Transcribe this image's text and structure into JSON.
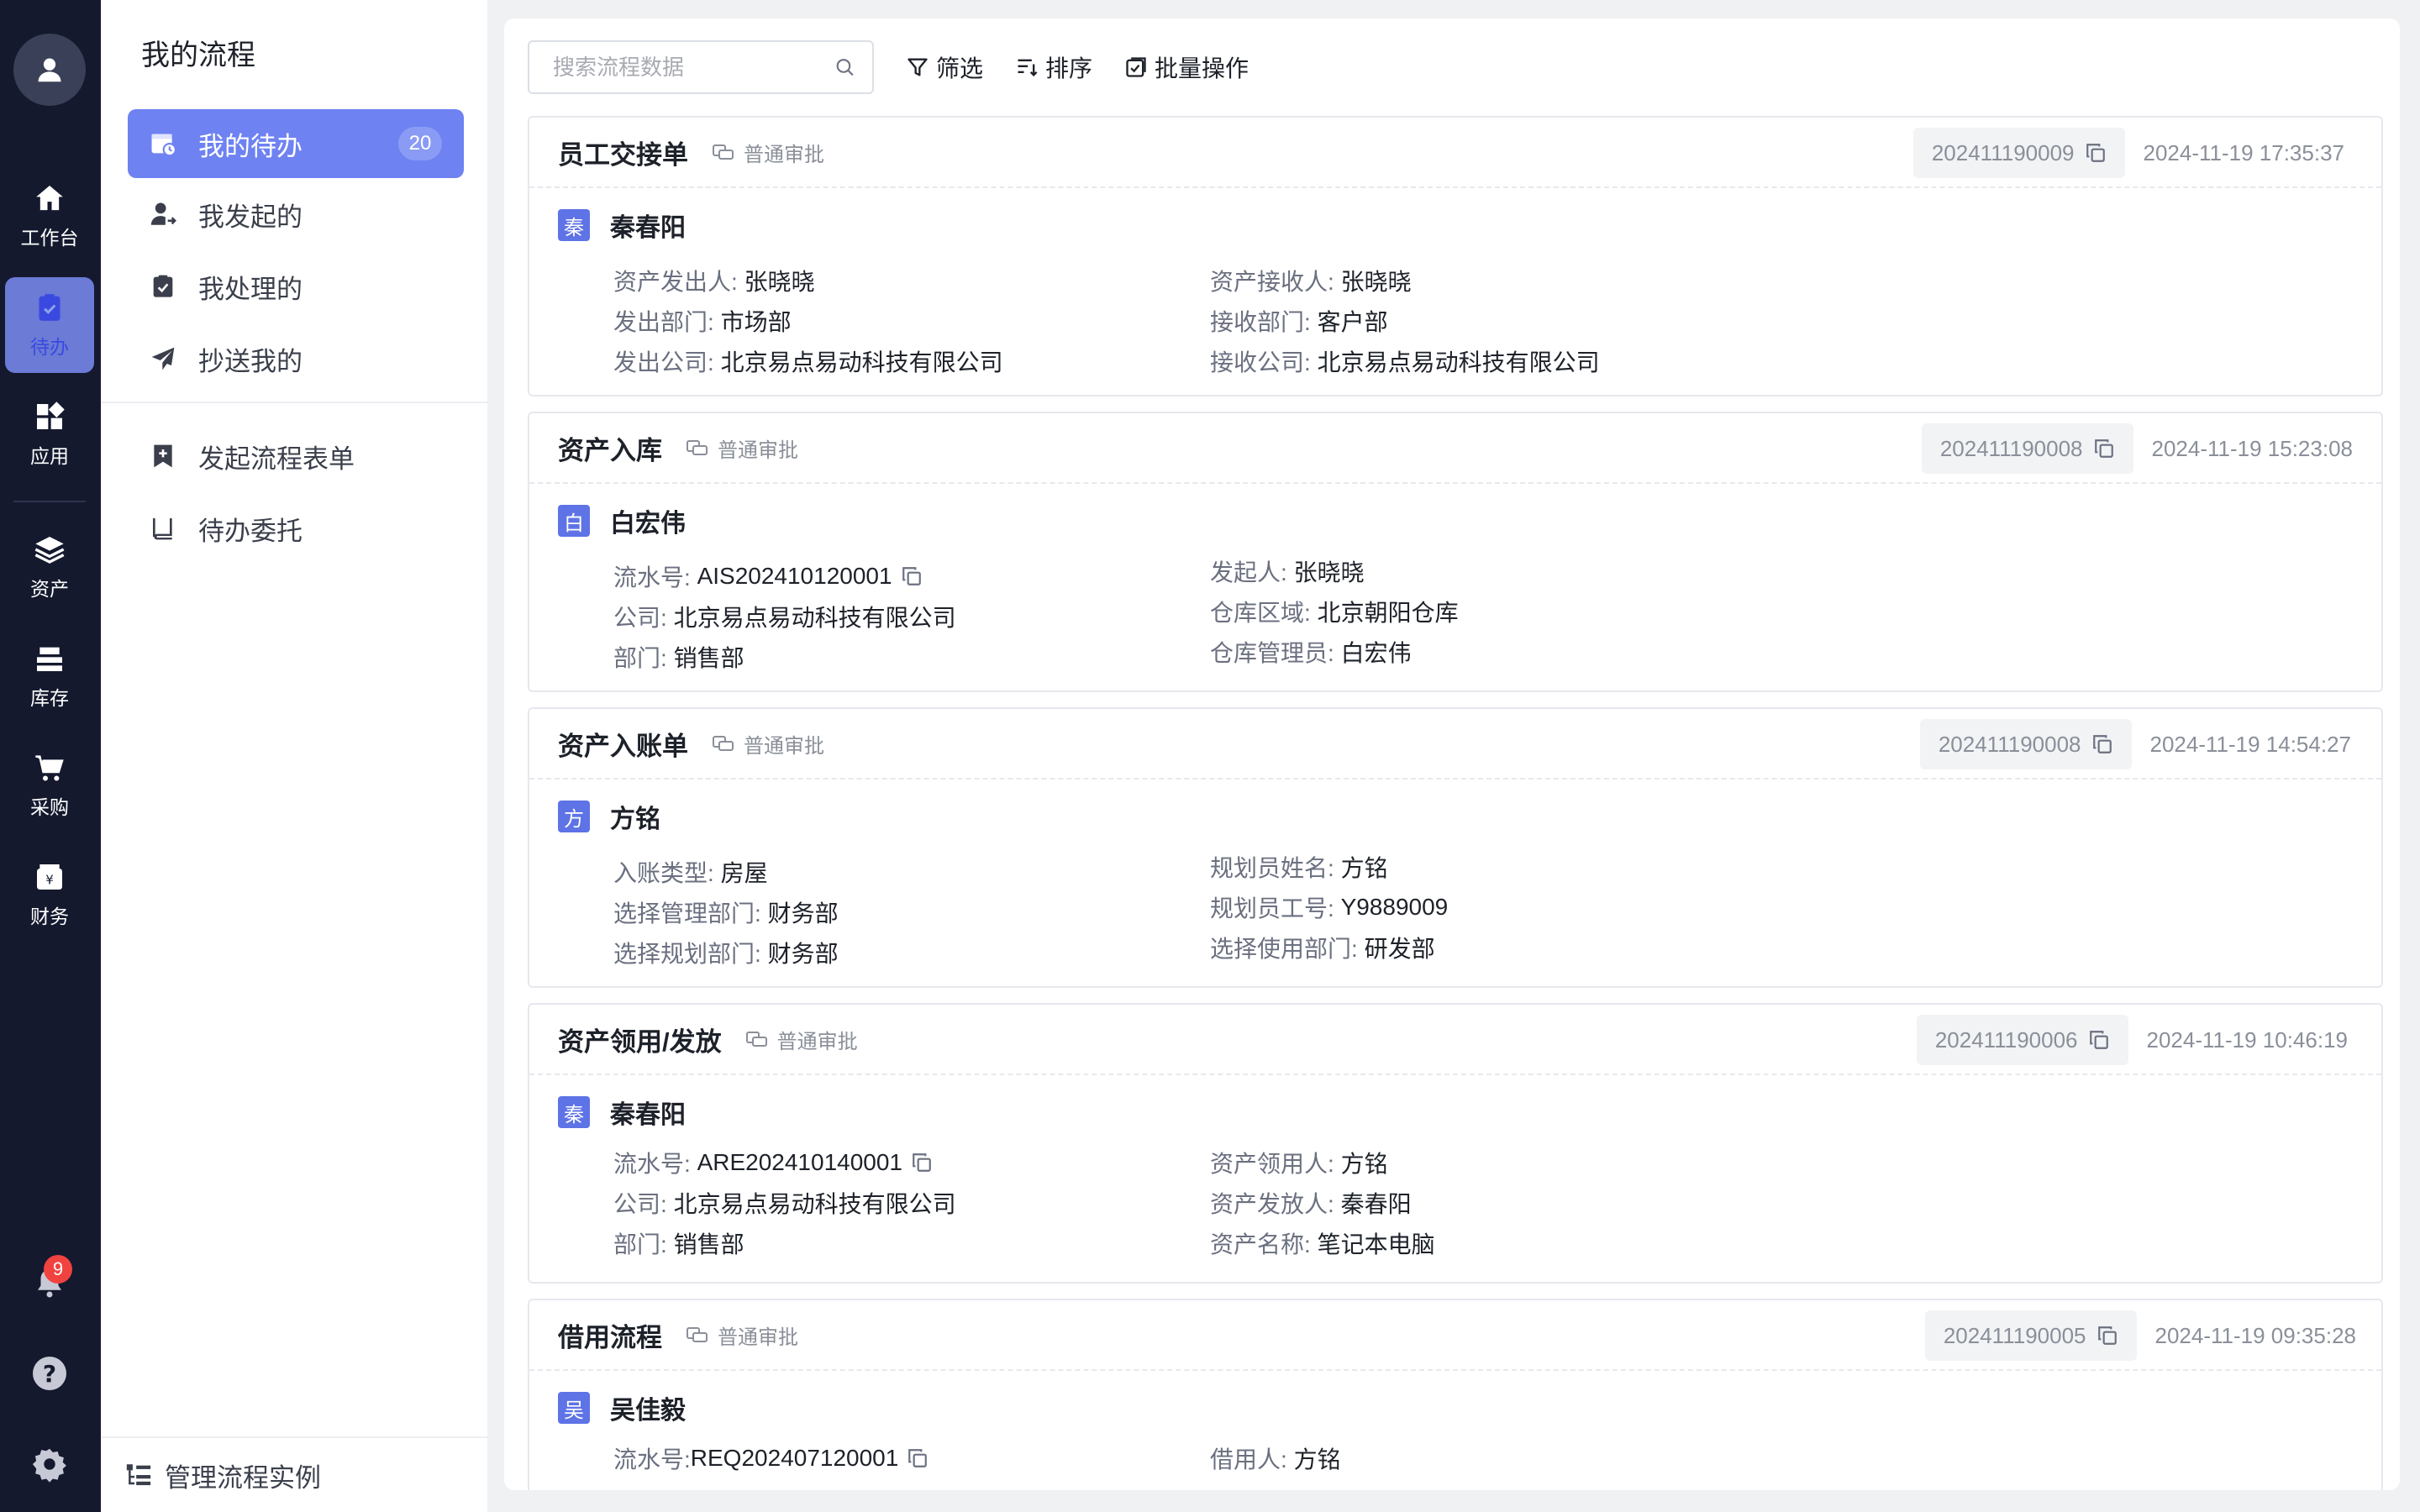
{
  "rail": {
    "items": [
      {
        "label": "工作台"
      },
      {
        "label": "待办"
      },
      {
        "label": "应用"
      },
      {
        "label": "资产"
      },
      {
        "label": "库存"
      },
      {
        "label": "采购"
      },
      {
        "label": "财务"
      }
    ],
    "notification_count": "9"
  },
  "sidebar": {
    "title": "我的流程",
    "items": [
      {
        "label": "我的待办",
        "count": "20"
      },
      {
        "label": "我发起的"
      },
      {
        "label": "我处理的"
      },
      {
        "label": "抄送我的"
      },
      {
        "label": "发起流程表单"
      },
      {
        "label": "待办委托"
      }
    ],
    "footer": "管理流程实例"
  },
  "toolbar": {
    "search_placeholder": "搜索流程数据",
    "filter": "筛选",
    "sort": "排序",
    "batch": "批量操作"
  },
  "cards": [
    {
      "title": "员工交接单",
      "tag": "普通审批",
      "flow_no": "202411190009",
      "time": "2024-11-19 17:35:37",
      "badge": "秦",
      "name": "秦春阳",
      "left": [
        {
          "k": "资产发出人:",
          "v": "张晓晓"
        },
        {
          "k": "发出部门:",
          "v": "市场部"
        },
        {
          "k": "发出公司:",
          "v": "北京易点易动科技有限公司"
        }
      ],
      "right": [
        {
          "k": "资产接收人:",
          "v": "张晓晓"
        },
        {
          "k": "接收部门:",
          "v": "客户部"
        },
        {
          "k": "接收公司:",
          "v": "北京易点易动科技有限公司"
        }
      ]
    },
    {
      "title": "资产入库",
      "tag": "普通审批",
      "flow_no": "202411190008",
      "time": "2024-11-19 15:23:08",
      "badge": "白",
      "name": "白宏伟",
      "left": [
        {
          "k": "流水号:",
          "v": "AIS202410120001"
        },
        {
          "k": "公司:",
          "v": "北京易点易动科技有限公司"
        },
        {
          "k": "部门:",
          "v": "销售部"
        }
      ],
      "right": [
        {
          "k": "发起人:",
          "v": "张晓晓"
        },
        {
          "k": "仓库区域:",
          "v": "北京朝阳仓库"
        },
        {
          "k": "仓库管理员:",
          "v": "白宏伟"
        }
      ]
    },
    {
      "title": "资产入账单",
      "tag": "普通审批",
      "flow_no": "202411190008",
      "time": "2024-11-19 14:54:27",
      "badge": "方",
      "name": "方铭",
      "left": [
        {
          "k": "入账类型:",
          "v": "房屋"
        },
        {
          "k": "选择管理部门:",
          "v": "财务部"
        },
        {
          "k": "选择规划部门:",
          "v": "财务部"
        }
      ],
      "right": [
        {
          "k": "规划员姓名:",
          "v": "方铭"
        },
        {
          "k": "规划员工号:",
          "v": "Y9889009"
        },
        {
          "k": "选择使用部门:",
          "v": "研发部"
        }
      ]
    },
    {
      "title": "资产领用/发放",
      "tag": "普通审批",
      "flow_no": "202411190006",
      "time": "2024-11-19 10:46:19",
      "badge": "秦",
      "name": "秦春阳",
      "left": [
        {
          "k": "流水号:",
          "v": "ARE202410140001"
        },
        {
          "k": "公司:",
          "v": "北京易点易动科技有限公司"
        },
        {
          "k": "部门:",
          "v": "销售部"
        }
      ],
      "right": [
        {
          "k": "资产领用人:",
          "v": "方铭"
        },
        {
          "k": "资产发放人:",
          "v": "秦春阳"
        },
        {
          "k": "资产名称:",
          "v": "笔记本电脑"
        }
      ]
    },
    {
      "title": "借用流程",
      "tag": "普通审批",
      "flow_no": "202411190005",
      "time": "2024-11-19 09:35:28",
      "badge": "吴",
      "name": "吴佳毅",
      "left": [
        {
          "k": "流水号:",
          "v": "REQ202407120001"
        }
      ],
      "right": [
        {
          "k": "借用人:",
          "v": "方铭"
        }
      ]
    }
  ]
}
